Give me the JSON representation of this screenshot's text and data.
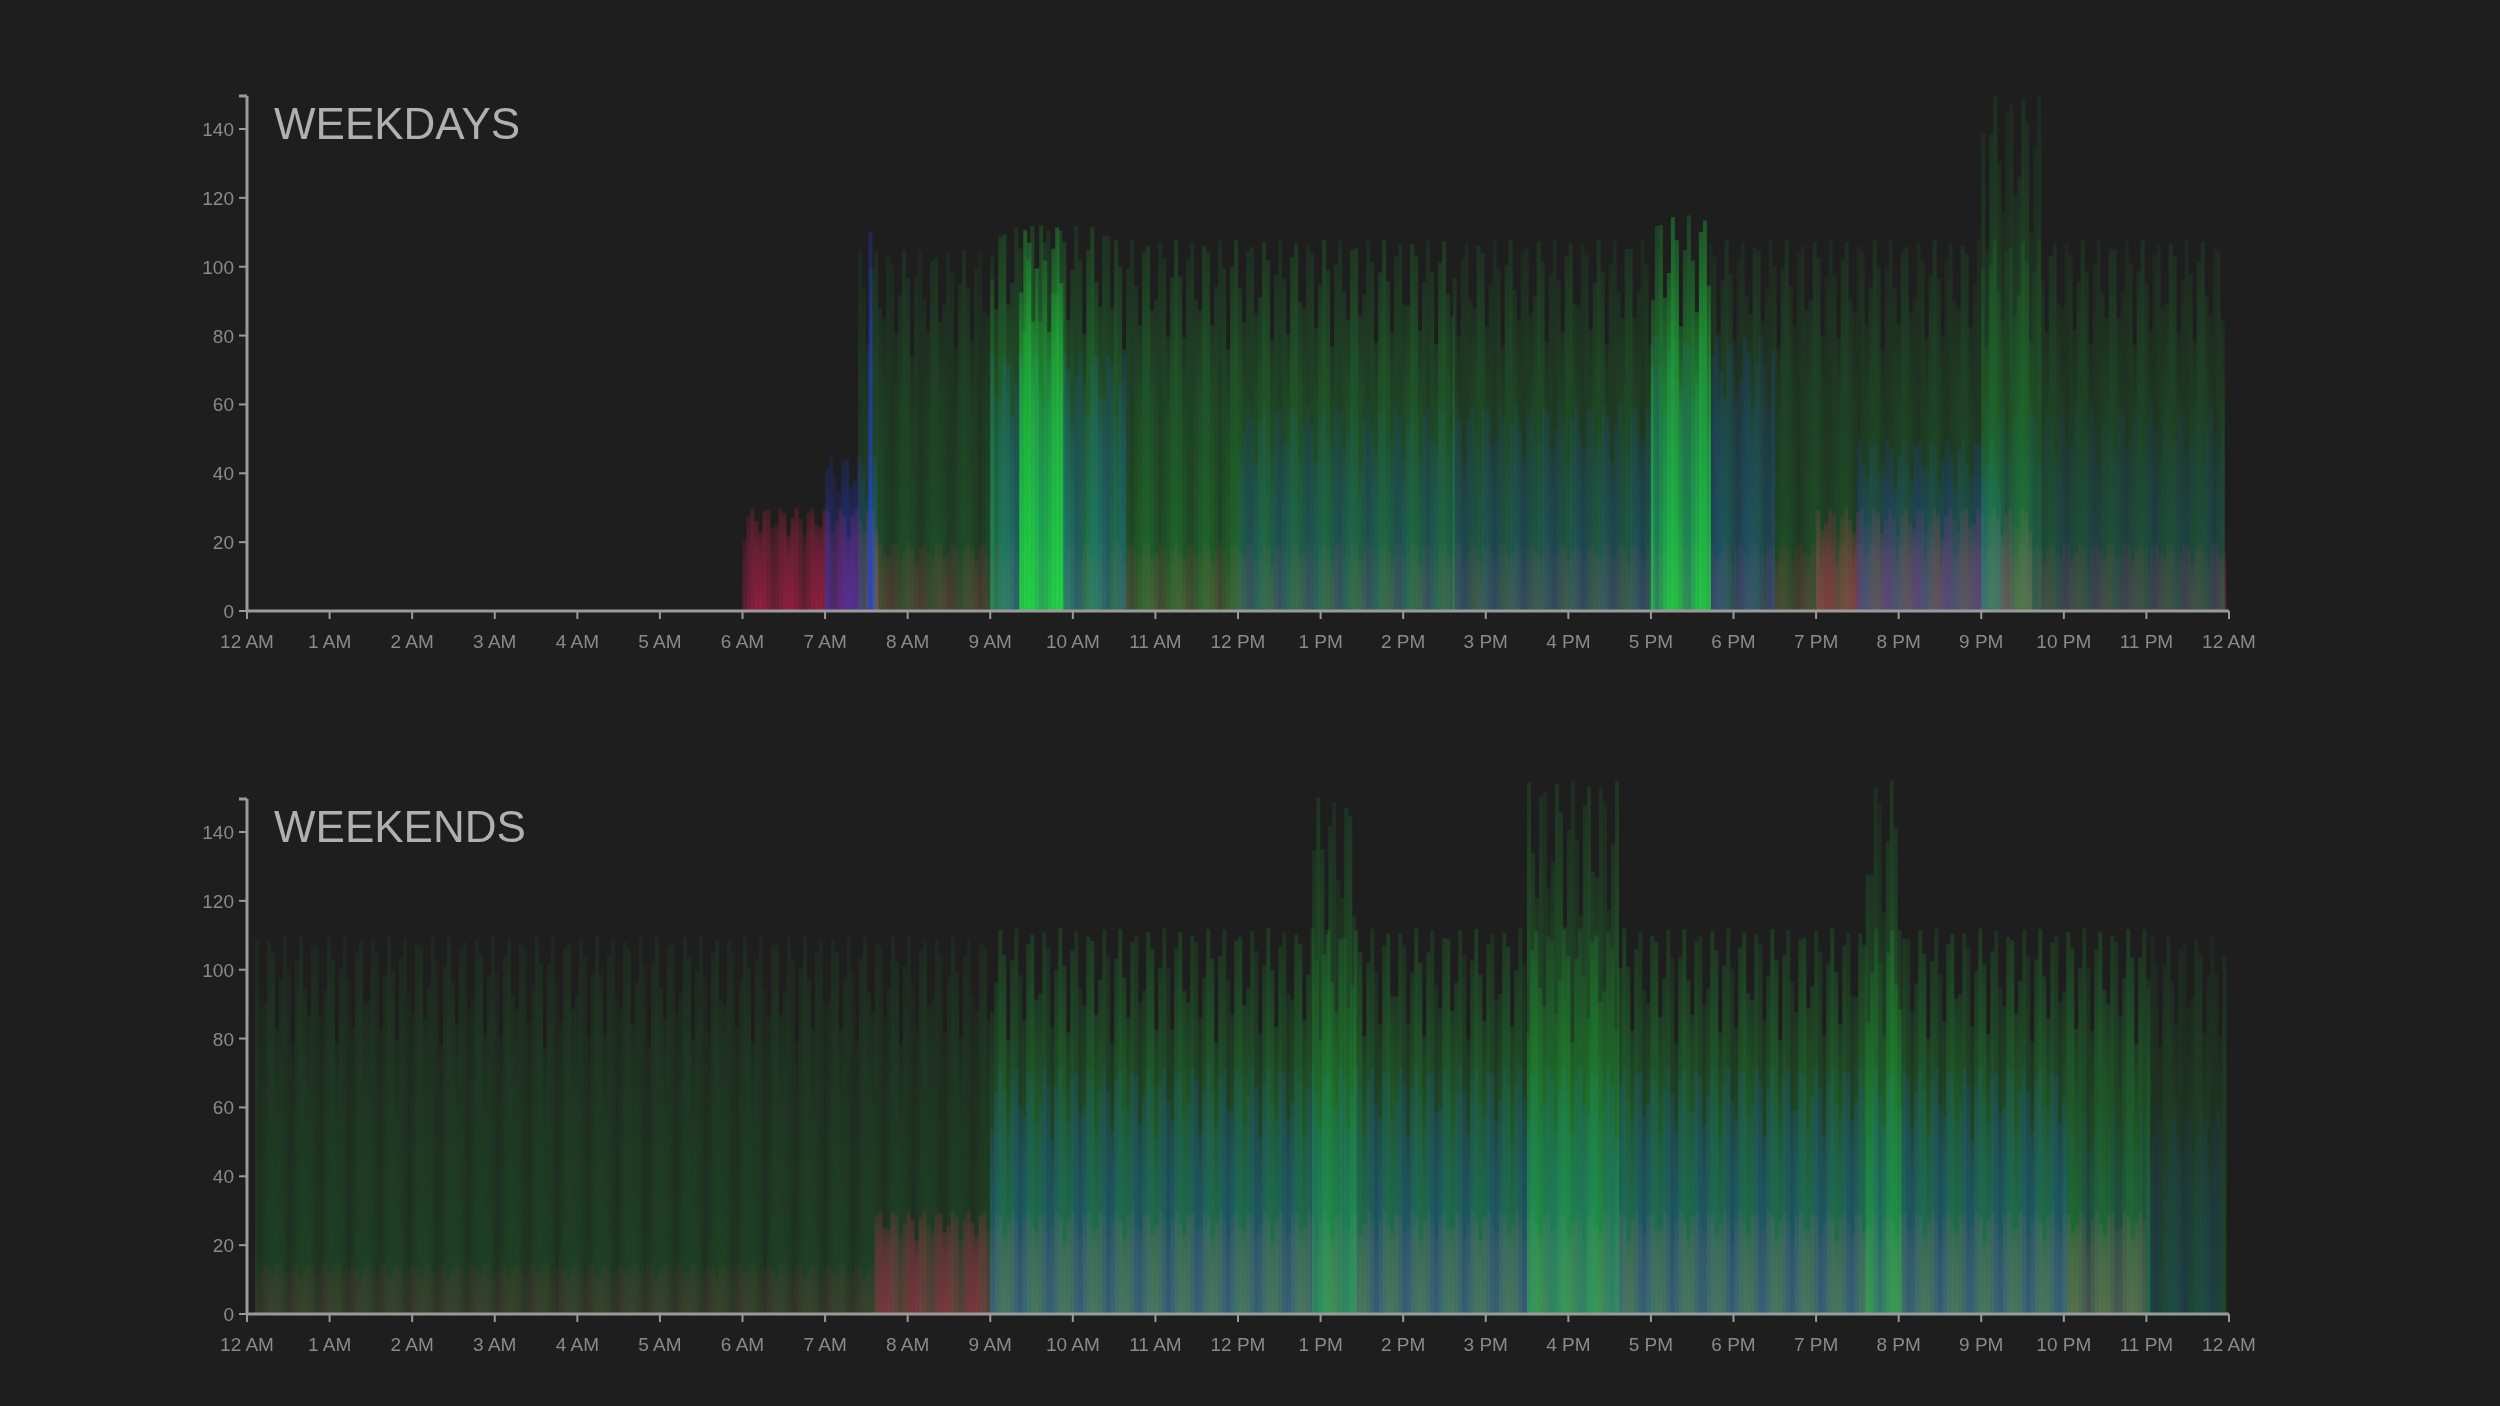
{
  "charts": [
    {
      "title": "WEEKDAYS",
      "y_ticks": [
        "140",
        "120",
        "100",
        "80",
        "60",
        "40",
        "20",
        "0"
      ],
      "x_ticks": [
        "12 AM",
        "1 AM",
        "2 AM",
        "3 AM",
        "4 AM",
        "5 AM",
        "6 AM",
        "7 AM",
        "8 AM",
        "9 AM",
        "10 AM",
        "11 AM",
        "12 PM",
        "1 PM",
        "2 PM",
        "3 PM",
        "4 PM",
        "5 PM",
        "6 PM",
        "7 PM",
        "8 PM",
        "9 PM",
        "10 PM",
        "11 PM",
        "12 AM"
      ]
    },
    {
      "title": "WEEKENDS",
      "y_ticks": [
        "140",
        "120",
        "100",
        "80",
        "60",
        "40",
        "20",
        "0"
      ],
      "x_ticks": [
        "12 AM",
        "1 AM",
        "2 AM",
        "3 AM",
        "4 AM",
        "5 AM",
        "6 AM",
        "7 AM",
        "8 AM",
        "9 AM",
        "10 AM",
        "11 AM",
        "12 PM",
        "1 PM",
        "2 PM",
        "3 PM",
        "4 PM",
        "5 PM",
        "6 PM",
        "7 PM",
        "8 PM",
        "9 PM",
        "10 PM",
        "11 PM",
        "12 AM"
      ]
    }
  ]
}
